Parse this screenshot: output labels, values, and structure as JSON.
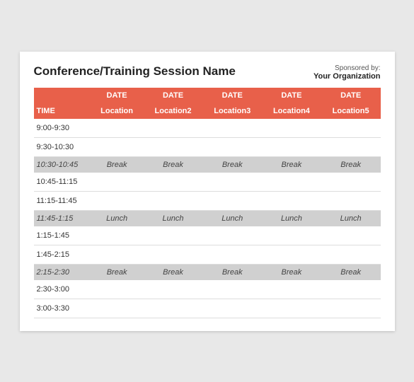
{
  "header": {
    "title": "Conference/Training Session Name",
    "sponsored_by_label": "Sponsored by:",
    "org_name": "Your Organization"
  },
  "table": {
    "header_row": {
      "time_label": "",
      "col1": "DATE",
      "col2": "DATE",
      "col3": "DATE",
      "col4": "DATE",
      "col5": "DATE"
    },
    "subheader_row": {
      "time_label": "TIME",
      "col1": "Location",
      "col2": "Location2",
      "col3": "Location3",
      "col4": "Location4",
      "col5": "Location5"
    },
    "rows": [
      {
        "time": "9:00-9:30",
        "type": "normal",
        "values": [
          "",
          "",
          "",
          "",
          ""
        ]
      },
      {
        "time": "9:30-10:30",
        "type": "normal",
        "values": [
          "",
          "",
          "",
          "",
          ""
        ]
      },
      {
        "time": "10:30-10:45",
        "type": "break",
        "values": [
          "Break",
          "Break",
          "Break",
          "Break",
          "Break"
        ]
      },
      {
        "time": "10:45-11:15",
        "type": "normal",
        "values": [
          "",
          "",
          "",
          "",
          ""
        ]
      },
      {
        "time": "11:15-11:45",
        "type": "normal",
        "values": [
          "",
          "",
          "",
          "",
          ""
        ]
      },
      {
        "time": "11:45-1:15",
        "type": "break",
        "values": [
          "Lunch",
          "Lunch",
          "Lunch",
          "Lunch",
          "Lunch"
        ]
      },
      {
        "time": "1:15-1:45",
        "type": "normal",
        "values": [
          "",
          "",
          "",
          "",
          ""
        ]
      },
      {
        "time": "1:45-2:15",
        "type": "normal",
        "values": [
          "",
          "",
          "",
          "",
          ""
        ]
      },
      {
        "time": "2:15-2:30",
        "type": "break",
        "values": [
          "Break",
          "Break",
          "Break",
          "Break",
          "Break"
        ]
      },
      {
        "time": "2:30-3:00",
        "type": "normal",
        "values": [
          "",
          "",
          "",
          "",
          ""
        ]
      },
      {
        "time": "3:00-3:30",
        "type": "normal",
        "values": [
          "",
          "",
          "",
          "",
          ""
        ]
      }
    ]
  }
}
